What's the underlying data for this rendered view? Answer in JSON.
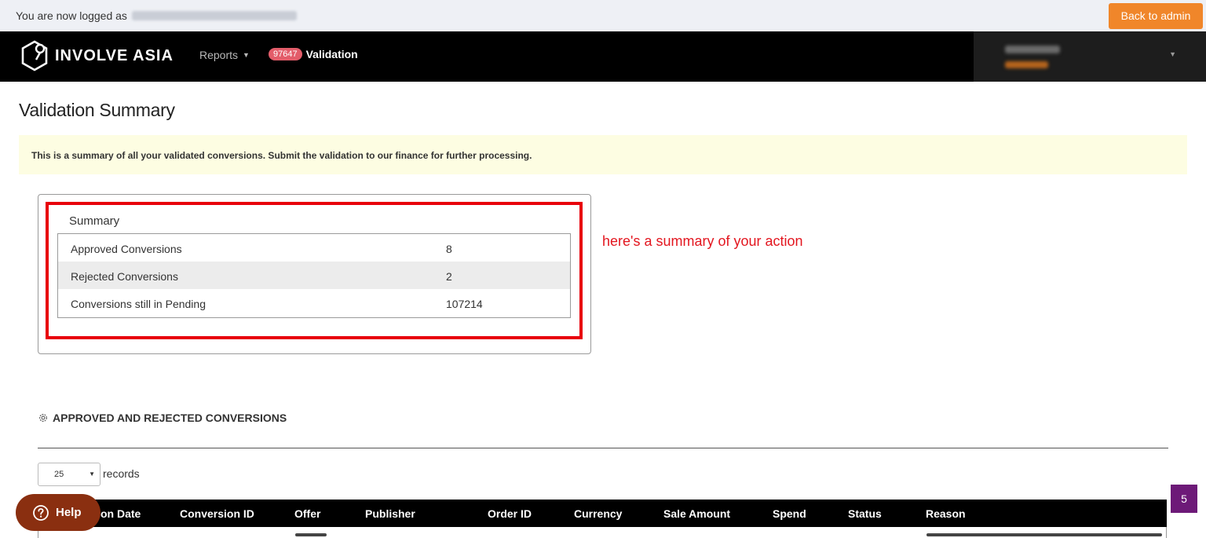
{
  "impersonation": {
    "text": "You are now logged as",
    "back_button": "Back to admin"
  },
  "navbar": {
    "brand": "INVOLVE ASIA",
    "reports_label": "Reports",
    "validation_count": "97647",
    "validation_label": "Validation"
  },
  "page": {
    "title": "Validation Summary",
    "info": "This is a summary of all your validated conversions. Submit the validation to our finance for further processing."
  },
  "summary": {
    "title": "Summary",
    "rows": [
      {
        "label": "Approved Conversions",
        "value": "8"
      },
      {
        "label": "Rejected Conversions",
        "value": "2"
      },
      {
        "label": "Conversions still in Pending",
        "value": "107214"
      }
    ],
    "annotation": "here's a summary of your action"
  },
  "conversions": {
    "section_title": "APPROVED AND REJECTED CONVERSIONS",
    "records_value": "25",
    "records_label": "records",
    "columns": [
      "on Date",
      "Conversion ID",
      "Offer",
      "Publisher",
      "Order ID",
      "Currency",
      "Sale Amount",
      "Spend",
      "Status",
      "Reason"
    ]
  },
  "help": {
    "label": "Help"
  },
  "side_tab": {
    "label": "5"
  },
  "colors": {
    "accent_orange": "#f0862a",
    "badge_red": "#e35d6a",
    "annotation_red": "#e8000b",
    "help_brown": "#8a2f10",
    "side_tab_purple": "#6d1a78",
    "info_bg": "#fdfde2"
  }
}
